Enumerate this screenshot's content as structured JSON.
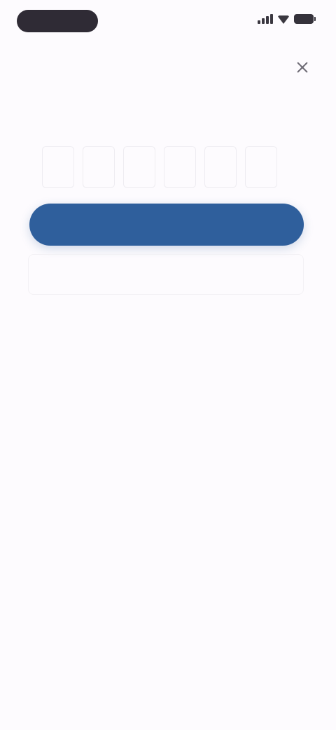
{
  "status_bar": {
    "signal_icon": "signal-icon",
    "wifi_icon": "wifi-icon",
    "battery_icon": "battery-icon"
  },
  "header": {
    "close_icon": "close-icon"
  },
  "main": {
    "title": "",
    "subtitle": "",
    "code_label": "",
    "code_length": 6,
    "code_values": [
      "",
      "",
      "",
      "",
      "",
      ""
    ],
    "code_placeholder": "",
    "primary_button_label": "",
    "resend_label": "",
    "alt_label": ""
  },
  "colors": {
    "background": "#fdfbfe",
    "primary": "#2f5f9c",
    "title_text": "#2a2830",
    "secondary_text": "#8e8b95"
  }
}
